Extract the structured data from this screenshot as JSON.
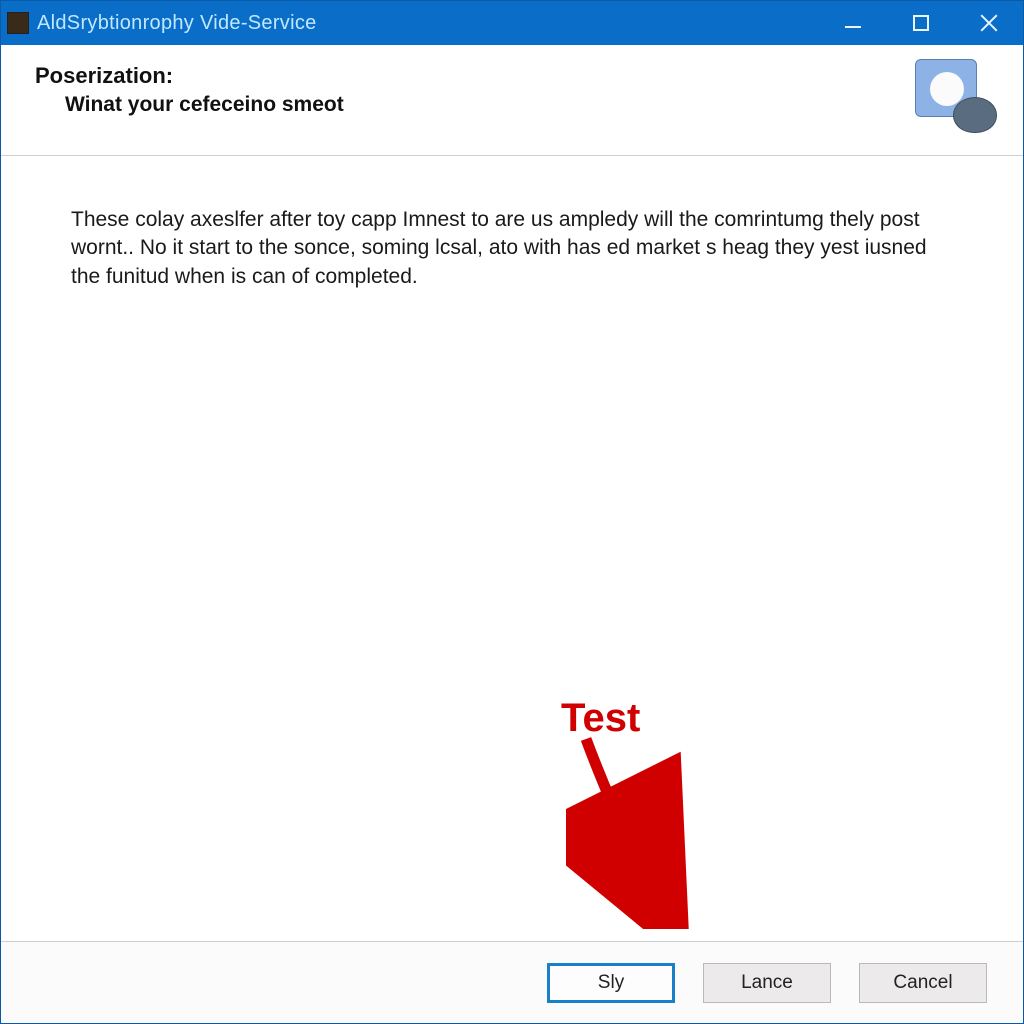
{
  "window": {
    "title": "AldSrybtionrophy Vide-Service"
  },
  "header": {
    "title": "Poserization:",
    "subtitle": "Winat your cefeceino smeot",
    "icon": "media-disc-icon"
  },
  "content": {
    "description": "These colay axeslfer after toy capp Imnest to are us  ampledy will the comrintumg thely post wornt.. No it start to the sonce, soming lcsal, ato with has ed market s heag they yest iusned the funitud when is can of completed."
  },
  "footer": {
    "primary_label": "Sly",
    "secondary_label": "Lance",
    "cancel_label": "Cancel"
  },
  "annotation": {
    "label": "Test"
  },
  "colors": {
    "titlebar": "#0a6ec9",
    "accent": "#1a7fc9",
    "annotation": "#d10000"
  }
}
